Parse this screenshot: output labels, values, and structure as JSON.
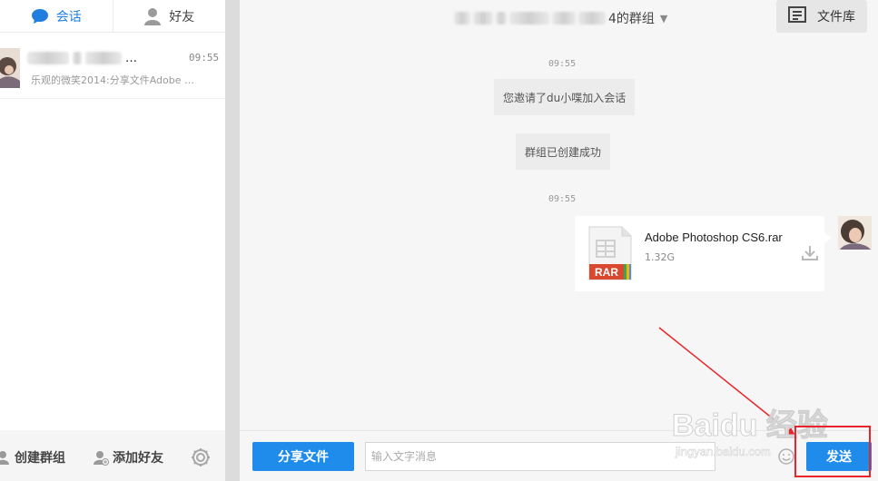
{
  "sidebar": {
    "tabs": [
      {
        "label": "会话",
        "icon": "chat-bubble-icon",
        "active": true
      },
      {
        "label": "好友",
        "icon": "person-icon",
        "active": false
      }
    ],
    "conversation": {
      "name_suffix": "…",
      "time": "09:55",
      "preview": "乐观的微笑2014:分享文件Adobe …",
      "avatar": "user-avatar"
    },
    "footer": {
      "create_group": "创建群组",
      "add_friend": "添加好友",
      "settings_icon": "gear-icon"
    }
  },
  "chat": {
    "title_suffix": "4的群组",
    "files_button": "文件库",
    "messages": {
      "time_1": "09:55",
      "system_1": "您邀请了du小喋加入会话",
      "system_2": "群组已创建成功",
      "time_2": "09:55",
      "file": {
        "name": "Adobe Photoshop CS6.rar",
        "size": "1.32G",
        "type_label": "RAR"
      }
    },
    "input": {
      "share_button": "分享文件",
      "placeholder": "输入文字消息",
      "send_button": "发送"
    }
  },
  "watermark": {
    "brand": "Baidu 经验",
    "url": "jingyan.baidu.com"
  },
  "colors": {
    "accent": "#1f8ceb",
    "active_tab": "#1f7ee0",
    "annotation_red": "#e8252a",
    "rar_red": "#d9482f"
  }
}
